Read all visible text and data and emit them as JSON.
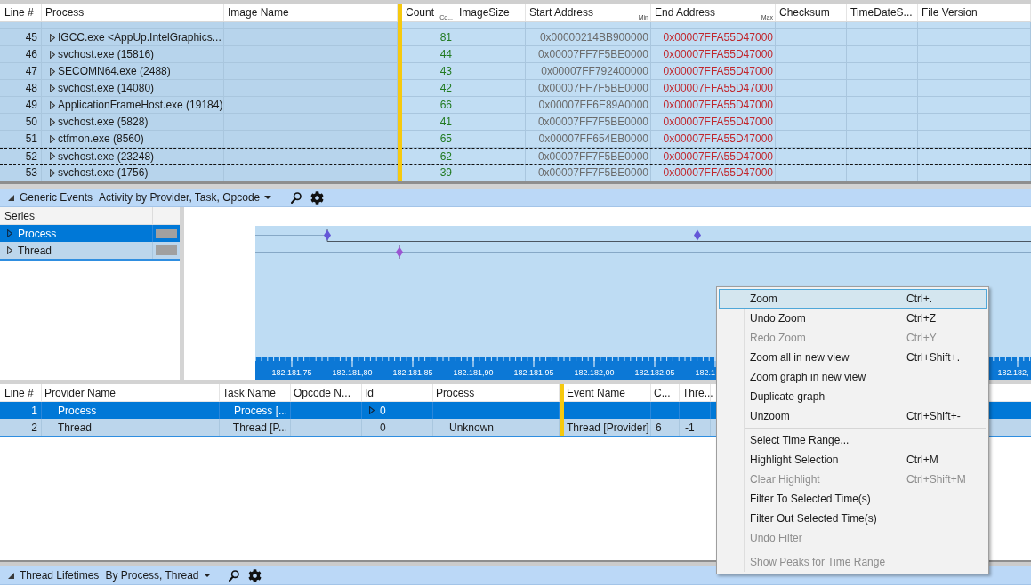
{
  "top_table": {
    "columns": [
      {
        "label": "Line #"
      },
      {
        "label": "Process"
      },
      {
        "label": "Image Name"
      },
      {
        "label": "Count",
        "sub": "Co..."
      },
      {
        "label": "ImageSize"
      },
      {
        "label": "Start Address",
        "sub": "Min"
      },
      {
        "label": "End Address",
        "sub": "Max"
      },
      {
        "label": "Checksum"
      },
      {
        "label": "TimeDateS..."
      },
      {
        "label": "File Version"
      }
    ],
    "rows": [
      {
        "line": "45",
        "process": "IGCC.exe <AppUp.IntelGraphics...",
        "count": "81",
        "start_address": "0x00000214BB900000",
        "end_address": "0x00007FFA55D47000",
        "selected": true,
        "focused": false
      },
      {
        "line": "46",
        "process": "svchost.exe (15816)",
        "count": "44",
        "start_address": "0x00007FF7F5BE0000",
        "end_address": "0x00007FFA55D47000",
        "selected": true,
        "focused": false
      },
      {
        "line": "47",
        "process": "SECOMN64.exe (2488)",
        "count": "43",
        "start_address": "0x00007FF792400000",
        "end_address": "0x00007FFA55D47000",
        "selected": true,
        "focused": false
      },
      {
        "line": "48",
        "process": "svchost.exe (14080)",
        "count": "42",
        "start_address": "0x00007FF7F5BE0000",
        "end_address": "0x00007FFA55D47000",
        "selected": true,
        "focused": false
      },
      {
        "line": "49",
        "process": "ApplicationFrameHost.exe (19184)",
        "count": "66",
        "start_address": "0x00007FF6E89A0000",
        "end_address": "0x00007FFA55D47000",
        "selected": true,
        "focused": false
      },
      {
        "line": "50",
        "process": "svchost.exe (5828)",
        "count": "41",
        "start_address": "0x00007FF7F5BE0000",
        "end_address": "0x00007FFA55D47000",
        "selected": true,
        "focused": false
      },
      {
        "line": "51",
        "process": "ctfmon.exe (8560)",
        "count": "65",
        "start_address": "0x00007FF654EB0000",
        "end_address": "0x00007FFA55D47000",
        "selected": true,
        "focused": false
      },
      {
        "line": "52",
        "process": "svchost.exe (23248)",
        "count": "62",
        "start_address": "0x00007FF7F5BE0000",
        "end_address": "0x00007FFA55D47000",
        "selected": true,
        "focused": true
      },
      {
        "line": "53",
        "process": "svchost.exe (1756)",
        "count": "39",
        "start_address": "0x00007FF7F5BE0000",
        "end_address": "0x00007FFA55D47000",
        "selected": true,
        "focused": false
      }
    ]
  },
  "generic_events": {
    "expanded": true,
    "title": "Generic Events",
    "preset": "Activity by Provider, Task, Opcode",
    "series_header": "Series",
    "series": [
      {
        "label": "Process",
        "selected": true
      },
      {
        "label": "Thread",
        "selected": false
      }
    ],
    "time_axis_labels": [
      "182.181,75",
      "182.181,80",
      "182.181,85",
      "182.181,90",
      "182.181,95",
      "182.182,00",
      "182.182,05",
      "182.1",
      "182.182,"
    ],
    "table": {
      "columns": [
        {
          "label": "Line #"
        },
        {
          "label": "Provider Name"
        },
        {
          "label": "Task Name"
        },
        {
          "label": "Opcode N..."
        },
        {
          "label": "Id"
        },
        {
          "label": "Process"
        },
        {
          "label": "Event Name"
        },
        {
          "label": "C..."
        },
        {
          "label": "Thre..."
        }
      ],
      "rows": [
        {
          "line": "1",
          "provider_name": "Process",
          "task_name": "Process [...",
          "id": "0",
          "has_children": true,
          "selected": true
        },
        {
          "line": "2",
          "provider_name": "Thread",
          "task_name": "Thread [P...",
          "id": "0",
          "process": "Unknown",
          "event_name": "Thread [Provider]",
          "c": "6",
          "thread": "-1",
          "has_children": false,
          "selected": false
        }
      ]
    }
  },
  "thread_lifetimes": {
    "expanded": true,
    "title": "Thread Lifetimes",
    "preset": "By Process, Thread"
  },
  "context_menu": {
    "items": [
      {
        "kind": "item",
        "label": "Zoom",
        "shortcut": "Ctrl+.",
        "selected": true,
        "disabled": false
      },
      {
        "kind": "item",
        "label": "Undo Zoom",
        "shortcut": "Ctrl+Z",
        "selected": false,
        "disabled": false
      },
      {
        "kind": "item",
        "label": "Redo Zoom",
        "shortcut": "Ctrl+Y",
        "selected": false,
        "disabled": true
      },
      {
        "kind": "item",
        "label": "Zoom all in new view",
        "shortcut": "Ctrl+Shift+.",
        "selected": false,
        "disabled": false
      },
      {
        "kind": "item",
        "label": "Zoom graph in new view",
        "selected": false,
        "disabled": false
      },
      {
        "kind": "item",
        "label": "Duplicate graph",
        "selected": false,
        "disabled": false
      },
      {
        "kind": "item",
        "label": "Unzoom",
        "shortcut": "Ctrl+Shift+-",
        "selected": false,
        "disabled": false
      },
      {
        "kind": "separator"
      },
      {
        "kind": "item",
        "label": "Select Time Range...",
        "selected": false,
        "disabled": false
      },
      {
        "kind": "item",
        "label": "Highlight Selection",
        "shortcut": "Ctrl+M",
        "selected": false,
        "disabled": false
      },
      {
        "kind": "item",
        "label": "Clear Highlight",
        "shortcut": "Ctrl+Shift+M",
        "selected": false,
        "disabled": true
      },
      {
        "kind": "item",
        "label": "Filter To Selected Time(s)",
        "selected": false,
        "disabled": false
      },
      {
        "kind": "item",
        "label": "Filter Out Selected Time(s)",
        "selected": false,
        "disabled": false
      },
      {
        "kind": "item",
        "label": "Undo Filter",
        "selected": false,
        "disabled": true
      },
      {
        "kind": "separator"
      },
      {
        "kind": "item",
        "label": "Show Peaks for Time Range",
        "selected": false,
        "disabled": true
      }
    ]
  }
}
